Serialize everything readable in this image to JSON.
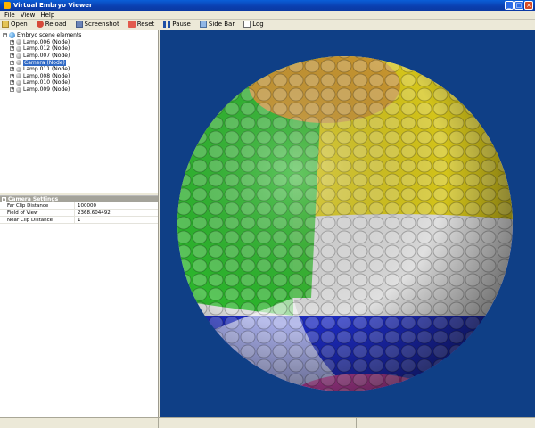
{
  "window": {
    "title": "Virtual Embryo Viewer",
    "controls": [
      "minimize",
      "maximize",
      "close"
    ]
  },
  "menu": {
    "items": [
      "File",
      "View",
      "Help"
    ]
  },
  "toolbar": {
    "buttons": [
      {
        "label": "Open",
        "icon": "folder-open-icon"
      },
      {
        "label": "Reload",
        "icon": "reload-icon"
      },
      {
        "label": "Screenshot",
        "icon": "camera-icon"
      },
      {
        "label": "Reset",
        "icon": "reset-icon"
      },
      {
        "label": "Pause",
        "icon": "pause-icon"
      },
      {
        "label": "Side Bar",
        "icon": "sidebar-icon"
      },
      {
        "label": "Log",
        "icon": "log-icon"
      }
    ]
  },
  "tree": {
    "root": "Embryo scene elements",
    "children": [
      "Lamp.006 (Node)",
      "Lamp.012 (Node)",
      "Lamp.007 (Node)",
      "Camera (Node)",
      "Lamp.011 (Node)",
      "Lamp.008 (Node)",
      "Lamp.010 (Node)",
      "Lamp.009 (Node)"
    ],
    "selected_index": 3
  },
  "properties": {
    "header": "Camera Settings",
    "rows": [
      {
        "key": "Far Clip Distance",
        "value": "100000"
      },
      {
        "key": "Field of View",
        "value": "2368.604492"
      },
      {
        "key": "Near Clip Distance",
        "value": "1"
      }
    ]
  },
  "colors": {
    "viewport_bg": "#0f3f86",
    "green": "#2db62d",
    "yellow": "#d4c41a",
    "white": "#d7d7d7",
    "blue": "#1e2bbf",
    "gold": "#c8962f",
    "pink": "#c042a6"
  }
}
